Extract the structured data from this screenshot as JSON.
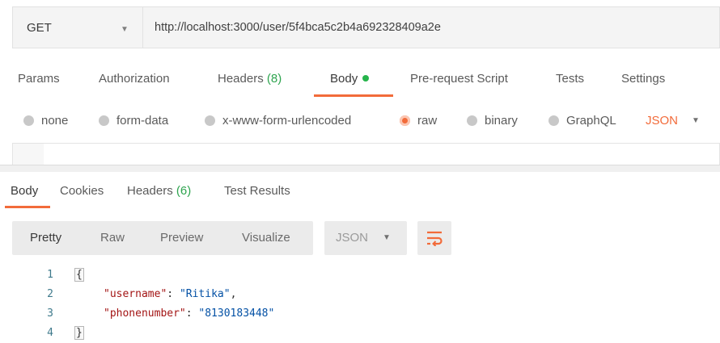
{
  "request": {
    "method": "GET",
    "url": "http://localhost:3000/user/5f4bca5c2b4a692328409a2e"
  },
  "request_tabs": {
    "params": "Params",
    "authorization": "Authorization",
    "headers": "Headers",
    "headers_count": "(8)",
    "body": "Body",
    "prerequest": "Pre-request Script",
    "tests": "Tests",
    "settings": "Settings"
  },
  "body_types": {
    "none": "none",
    "form_data": "form-data",
    "urlencoded": "x-www-form-urlencoded",
    "raw": "raw",
    "binary": "binary",
    "graphql": "GraphQL",
    "selected": "raw",
    "format": "JSON"
  },
  "response_tabs": {
    "body": "Body",
    "cookies": "Cookies",
    "headers": "Headers",
    "headers_count": "(6)",
    "test_results": "Test Results"
  },
  "response_toolbar": {
    "pretty": "Pretty",
    "raw": "Raw",
    "preview": "Preview",
    "visualize": "Visualize",
    "format": "JSON"
  },
  "response_body": {
    "line_numbers": [
      "1",
      "2",
      "3",
      "4"
    ],
    "open_brace": "{",
    "close_brace": "}",
    "fields": [
      {
        "key": "\"username\"",
        "value": "\"Ritika\"",
        "trail": ","
      },
      {
        "key": "\"phonenumber\"",
        "value": "\"8130183448\"",
        "trail": ""
      }
    ]
  },
  "colors": {
    "accent": "#f26b3a",
    "success": "#26b44b"
  }
}
